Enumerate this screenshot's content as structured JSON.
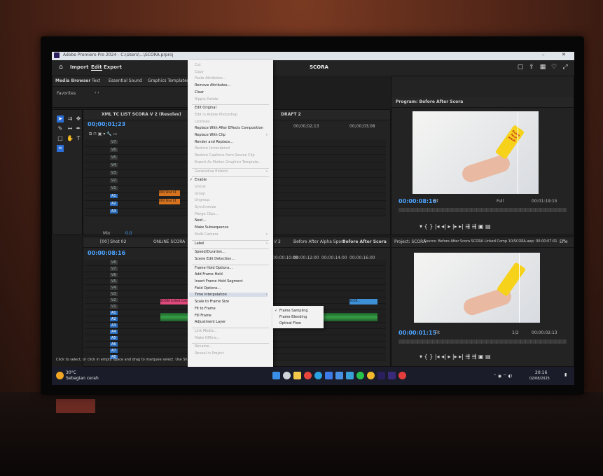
{
  "window": {
    "title": "Adobe Premiere Pro 2024 - C:\\Users\\...\\SCORA.prproj"
  },
  "topbar": {
    "tabs": [
      "Import",
      "Edit",
      "Export"
    ],
    "center_title": "SCORA"
  },
  "browser": {
    "tabs": [
      "Media Browser",
      "Text",
      "Essential Sound",
      "Graphics Templates"
    ],
    "favorites": "Favorites"
  },
  "timeline_top": {
    "sequence_tab": "XML TC LIST SCORA V 2 (Resolve)",
    "second_tab": "DRAFT 2",
    "timecode": "00;00;01;23",
    "ruler": [
      "00;00;02;13",
      "00;00;03;08"
    ],
    "video_tracks": [
      "V7",
      "V6",
      "V5",
      "V4",
      "V3",
      "V2",
      "V1"
    ],
    "audio_tracks": [
      "A1",
      "A2",
      "A3"
    ],
    "mix_label": "Mix",
    "mix_value": "0.0",
    "clips": [
      "[00] Shot 01",
      "[00] Shot 01"
    ]
  },
  "timeline_bottom": {
    "tabs": [
      "[00] Shot 02",
      "ONLINE SCORA",
      "V 2",
      "Before After Alpha Sport",
      "Before After Scora"
    ],
    "timecode": "00:00:08:16",
    "ruler": [
      "00:00:10:00",
      "00:00:12:00",
      "00:00:14:00",
      "00:00:16:00"
    ],
    "video_tracks": [
      "V8",
      "V7",
      "V6",
      "V5",
      "V4",
      "V3",
      "V2",
      "V1"
    ],
    "audio_tracks": [
      "A1",
      "A2",
      "A3",
      "A4",
      "A5",
      "A6",
      "A7",
      "A8"
    ],
    "clips": [
      "SCORA Linked Comp",
      "SCOR..."
    ]
  },
  "program": {
    "tab": "Program: Before After Scora",
    "timecode": "00:00:08:16",
    "fit": "Fit",
    "quality": "Full",
    "duration": "00:01:19:15"
  },
  "source": {
    "tabs": [
      "Project: SCORA",
      "Source: Before After Scora SCORA Linked Comp 10/SCORA.aep: 00:00:07:01",
      "Effe"
    ],
    "timecode": "00:00:01:15",
    "fit": "Fit",
    "quality": "1/2",
    "duration": "00:00:02:13"
  },
  "tube_label": "Scora face wash",
  "context_menu": {
    "items": [
      {
        "label": "Cut",
        "enabled": false
      },
      {
        "label": "Copy",
        "enabled": false
      },
      {
        "label": "Paste Attributes...",
        "enabled": false
      },
      {
        "label": "Remove Attributes...",
        "enabled": true
      },
      {
        "label": "Clear",
        "enabled": true
      },
      {
        "label": "Ripple Delete",
        "enabled": false
      },
      {
        "label": "Edit Original",
        "enabled": true
      },
      {
        "label": "Edit in Adobe Photoshop",
        "enabled": false
      },
      {
        "label": "Licenses",
        "enabled": false
      },
      {
        "label": "Replace With After Effects Composition",
        "enabled": true
      },
      {
        "label": "Replace With Clip",
        "enabled": true,
        "submenu": true
      },
      {
        "label": "Render and Replace...",
        "enabled": true
      },
      {
        "label": "Restore Unrendered",
        "enabled": false
      },
      {
        "label": "Restore Captions from Source Clip",
        "enabled": false
      },
      {
        "label": "Export As Motion Graphics Template...",
        "enabled": false
      },
      {
        "label": "Generative Extend",
        "enabled": false,
        "submenu": true
      },
      {
        "label": "Enable",
        "enabled": true,
        "checked": true
      },
      {
        "label": "Unlink",
        "enabled": false
      },
      {
        "label": "Group",
        "enabled": false
      },
      {
        "label": "Ungroup",
        "enabled": false
      },
      {
        "label": "Synchronize",
        "enabled": false
      },
      {
        "label": "Merge Clips...",
        "enabled": false
      },
      {
        "label": "Nest...",
        "enabled": true
      },
      {
        "label": "Make Subsequence",
        "enabled": true
      },
      {
        "label": "Multi-Camera",
        "enabled": false,
        "submenu": true
      },
      {
        "label": "Label",
        "enabled": true,
        "submenu": true
      },
      {
        "label": "Speed/Duration...",
        "enabled": true
      },
      {
        "label": "Scene Edit Detection...",
        "enabled": true
      },
      {
        "label": "Frame Hold Options...",
        "enabled": true
      },
      {
        "label": "Add Frame Hold",
        "enabled": true
      },
      {
        "label": "Insert Frame Hold Segment",
        "enabled": true
      },
      {
        "label": "Field Options...",
        "enabled": true
      },
      {
        "label": "Time Interpolation",
        "enabled": true,
        "submenu": true,
        "hover": true
      },
      {
        "label": "Scale to Frame Size",
        "enabled": true
      },
      {
        "label": "Fit to Frame",
        "enabled": true
      },
      {
        "label": "Fill Frame",
        "enabled": true
      },
      {
        "label": "Adjustment Layer",
        "enabled": true
      },
      {
        "label": "Link Media...",
        "enabled": false
      },
      {
        "label": "Make Offline...",
        "enabled": false
      },
      {
        "label": "Rename...",
        "enabled": false
      },
      {
        "label": "Reveal in Project",
        "enabled": false
      }
    ]
  },
  "submenu": {
    "items": [
      {
        "label": "Frame Sampling",
        "checked": true
      },
      {
        "label": "Frame Blending",
        "checked": false
      },
      {
        "label": "Optical Flow",
        "checked": false
      }
    ]
  },
  "status_bar": "Click to select, or click in empty space and drag to marquee select. Use Shift, Alt, and Ctrl for other options.",
  "taskbar": {
    "weather_temp": "30°C",
    "weather_desc": "Sebagian cerah",
    "time": "20:16",
    "date": "02/08/2025"
  },
  "colors": {
    "timecode": "#4aa3ff",
    "clip_orange": "#d7731f",
    "clip_pink": "#e0497b",
    "audio": "#37a046"
  }
}
